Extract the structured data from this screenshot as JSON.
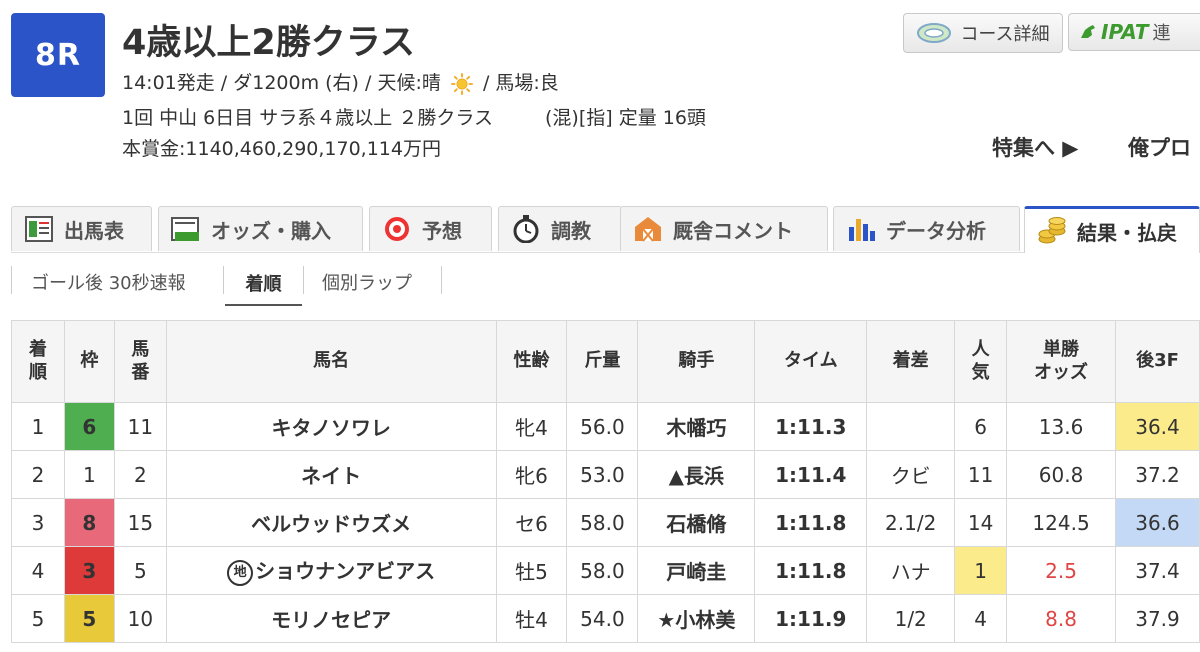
{
  "race": {
    "number": "8R",
    "title": "4歳以上2勝クラス",
    "line1_pre": "14:01発走 / ダ1200m (右) / 天候:晴",
    "line1_post": "/ 馬場:良",
    "line2_a": "1回 中山 6日目 サラ系４歳以上 ２勝クラス",
    "line2_b": "(混)[指] 定量 16頭",
    "prize": "本賞金:1140,460,290,170,114万円"
  },
  "header_buttons": {
    "course": "コース詳細",
    "ipat_logo": "IPAT",
    "ipat_text": "連"
  },
  "links": {
    "tokushu": "特集へ ▶",
    "ore": "俺プロ"
  },
  "tabs": [
    {
      "label": "出馬表",
      "icon": "entry-table-icon"
    },
    {
      "label": "オッズ・購入",
      "icon": "odds-ipat-icon"
    },
    {
      "label": "予想",
      "icon": "target-icon"
    },
    {
      "label": "調教",
      "icon": "stopwatch-icon"
    },
    {
      "label": "厩舎コメント",
      "icon": "stable-barn-icon"
    },
    {
      "label": "データ分析",
      "icon": "bar-chart-icon"
    },
    {
      "label": "結果・払戻",
      "icon": "coins-icon"
    }
  ],
  "subtabs": [
    "ゴール後 30秒速報",
    "着順",
    "個別ラップ"
  ],
  "table": {
    "headers": [
      [
        "着",
        "順"
      ],
      [
        "枠"
      ],
      [
        "馬",
        "番"
      ],
      [
        "馬名"
      ],
      [
        "性齢"
      ],
      [
        "斤量"
      ],
      [
        "騎手"
      ],
      [
        "タイム"
      ],
      [
        "着差"
      ],
      [
        "人",
        "気"
      ],
      [
        "単勝",
        "オッズ"
      ],
      [
        "後3F"
      ]
    ],
    "rows": [
      {
        "rank": "1",
        "frame": "6",
        "frame_color": "#4fae4f",
        "num": "11",
        "chihou": "",
        "name": "キタノソワレ",
        "sexage": "牝4",
        "weight": "56.0",
        "jockey": "木幡巧",
        "time": "1:11.3",
        "margin": "",
        "pop": "6",
        "pop_highlight": "",
        "odds": "13.6",
        "odds_hot": false,
        "l3f": "36.4",
        "l3f_color": "#fbeb8a"
      },
      {
        "rank": "2",
        "frame": "1",
        "frame_color": "#ffffff",
        "num": "2",
        "chihou": "",
        "name": "ネイト",
        "sexage": "牝6",
        "weight": "53.0",
        "jockey": "▲長浜",
        "time": "1:11.4",
        "margin": "クビ",
        "pop": "11",
        "pop_highlight": "",
        "odds": "60.8",
        "odds_hot": false,
        "l3f": "37.2",
        "l3f_color": ""
      },
      {
        "rank": "3",
        "frame": "8",
        "frame_color": "#e8697a",
        "num": "15",
        "chihou": "",
        "name": "ベルウッドウズメ",
        "sexage": "セ6",
        "weight": "58.0",
        "jockey": "石橋脩",
        "time": "1:11.8",
        "margin": "2.1/2",
        "pop": "14",
        "pop_highlight": "",
        "odds": "124.5",
        "odds_hot": false,
        "l3f": "36.6",
        "l3f_color": "#c4d9f5"
      },
      {
        "rank": "4",
        "frame": "3",
        "frame_color": "#df3a3a",
        "num": "5",
        "chihou": "地",
        "name": "ショウナンアビアス",
        "sexage": "牡5",
        "weight": "58.0",
        "jockey": "戸崎圭",
        "time": "1:11.8",
        "margin": "ハナ",
        "pop": "1",
        "pop_highlight": "#fbeb8a",
        "odds": "2.5",
        "odds_hot": true,
        "l3f": "37.4",
        "l3f_color": ""
      },
      {
        "rank": "5",
        "frame": "5",
        "frame_color": "#e8c93a",
        "num": "10",
        "chihou": "",
        "name": "モリノセピア",
        "sexage": "牡4",
        "weight": "54.0",
        "jockey": "★小林美",
        "time": "1:11.9",
        "margin": "1/2",
        "pop": "4",
        "pop_highlight": "",
        "odds": "8.8",
        "odds_hot": true,
        "l3f": "37.9",
        "l3f_color": ""
      }
    ]
  }
}
